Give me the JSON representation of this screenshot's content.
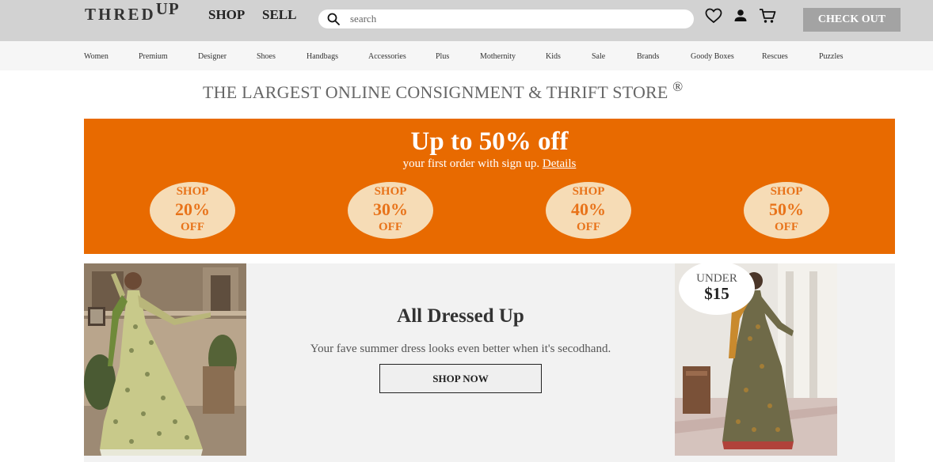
{
  "brand": {
    "logo_main": "THRED",
    "logo_sup": "UP"
  },
  "topnav": {
    "shop": "SHOP",
    "sell": "SELL"
  },
  "search": {
    "placeholder": "search",
    "icon": "search-icon"
  },
  "header_icons": [
    "heart-icon",
    "user-icon",
    "cart-icon"
  ],
  "checkout_label": "CHECK OUT",
  "categories": [
    "Women",
    "Premium",
    "Designer",
    "Shoes",
    "Handbags",
    "Accessories",
    "Plus",
    "Mothernity",
    "Kids",
    "Sale",
    "Brands",
    "Goody Boxes",
    "Rescues",
    "Puzzles"
  ],
  "headline": {
    "text": "THE LARGEST ONLINE CONSIGNMENT & THRIFT STORE",
    "mark": "®"
  },
  "promo": {
    "title": "Up to 50% off",
    "subtitle": "your first order with sign up.",
    "details_link": "Details",
    "offers": [
      {
        "top": "SHOP",
        "pct": "20%",
        "bottom": "OFF"
      },
      {
        "top": "SHOP",
        "pct": "30%",
        "bottom": "OFF"
      },
      {
        "top": "SHOP",
        "pct": "40%",
        "bottom": "OFF"
      },
      {
        "top": "SHOP",
        "pct": "50%",
        "bottom": "OFF"
      }
    ],
    "colors": {
      "background": "#e86a00",
      "badge": "#f6dcb6",
      "badge_text": "#e8731a"
    }
  },
  "feature": {
    "title": "All Dressed Up",
    "text": "Your fave summer dress looks even better when it's secodhand.",
    "cta": "SHOP NOW",
    "badge_line1": "UNDER",
    "badge_line2": "$15"
  }
}
